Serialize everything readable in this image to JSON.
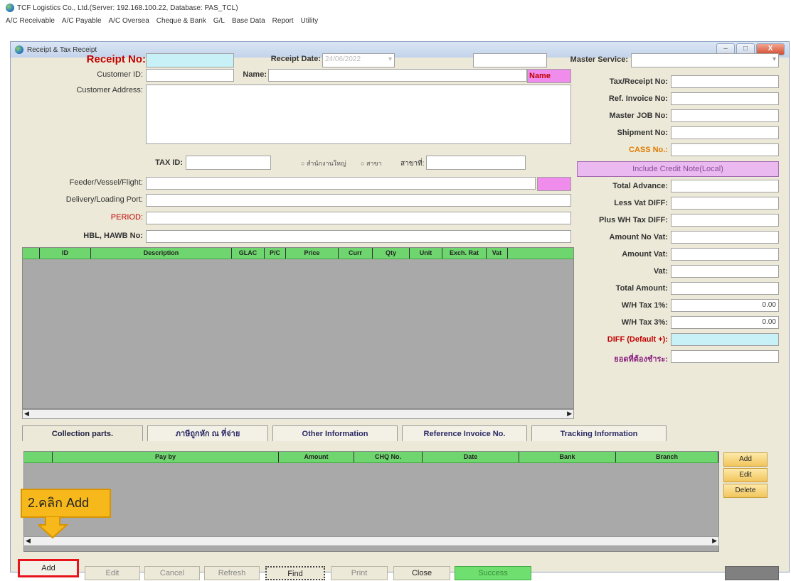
{
  "app": {
    "title": "TCF Logistics Co., Ltd.(Server: 192.168.100.22, Database: PAS_TCL)"
  },
  "menu": [
    "A/C Receivable",
    "A/C Payable",
    "A/C Oversea",
    "Cheque & Bank",
    "G/L",
    "Base Data",
    "Report",
    "Utility"
  ],
  "window": {
    "title": "Receipt & Tax Receipt",
    "btn_min": "–",
    "btn_max": "□",
    "btn_close": "X"
  },
  "form": {
    "receipt_no_label": "Receipt No:",
    "receipt_date_label": "Receipt Date:",
    "receipt_date_value": "24/06/2022",
    "master_service_label": "Master Service:",
    "customer_id_label": "Customer ID:",
    "name_label": "Name:",
    "name_button": "Name",
    "customer_address_label": "Customer Address:",
    "tax_id_label": "TAX ID:",
    "radio_hq": "สำนักงานใหญ่",
    "radio_branch": "สาขา",
    "branch_no_label": "สาขาที่:",
    "feeder_label": "Feeder/Vessel/Flight:",
    "delivery_label": "Delivery/Loading Port:",
    "period_label": "PERIOD:",
    "hbl_label": "HBL, HAWB No:"
  },
  "right_panel": {
    "labels": [
      "Tax/Receipt No:",
      "Ref. Invoice No:",
      "Master JOB No:",
      "Shipment No:",
      "CASS No.:"
    ],
    "include_credit": "Include Credit Note(Local)",
    "totals": [
      {
        "label": "Total Advance:",
        "value": ""
      },
      {
        "label": "Less Vat DIFF:",
        "value": ""
      },
      {
        "label": "Plus WH Tax DIFF:",
        "value": ""
      },
      {
        "label": "Amount No Vat:",
        "value": ""
      },
      {
        "label": "Amount Vat:",
        "value": ""
      },
      {
        "label": "Vat:",
        "value": ""
      },
      {
        "label": "Total Amount:",
        "value": ""
      },
      {
        "label": "W/H Tax 1%:",
        "value": "0.00"
      },
      {
        "label": "W/H Tax 3%:",
        "value": "0.00"
      },
      {
        "label": "DIFF (Default +):",
        "value": ""
      },
      {
        "label": "ยอดที่ต้องชำระ:",
        "value": ""
      }
    ]
  },
  "detail_grid": {
    "columns": [
      "ID",
      "Description",
      "GLAC",
      "P/C",
      "Price",
      "Curr",
      "Qty",
      "Unit",
      "Exch. Rat",
      "Vat"
    ]
  },
  "tabs": [
    "Collection parts.",
    "ภาษีถูกหัก ณ ที่จ่าย",
    "Other Information",
    "Reference Invoice No.",
    "Tracking Information"
  ],
  "payment_grid": {
    "columns": [
      "Pay by",
      "Amount",
      "CHQ No.",
      "Date",
      "Bank",
      "Branch"
    ]
  },
  "side_buttons": [
    "Add",
    "Edit",
    "Delete"
  ],
  "bottom_buttons": [
    "Add",
    "Edit",
    "Cancel",
    "Refresh",
    "Find",
    "Print",
    "Close",
    "Success"
  ],
  "callout": "2.คลิก Add",
  "colors": {
    "highlight": "#e8141b",
    "callout": "#f6b81b",
    "grid_header": "#6fd66f",
    "cyan_field": "#c7f1f7"
  }
}
